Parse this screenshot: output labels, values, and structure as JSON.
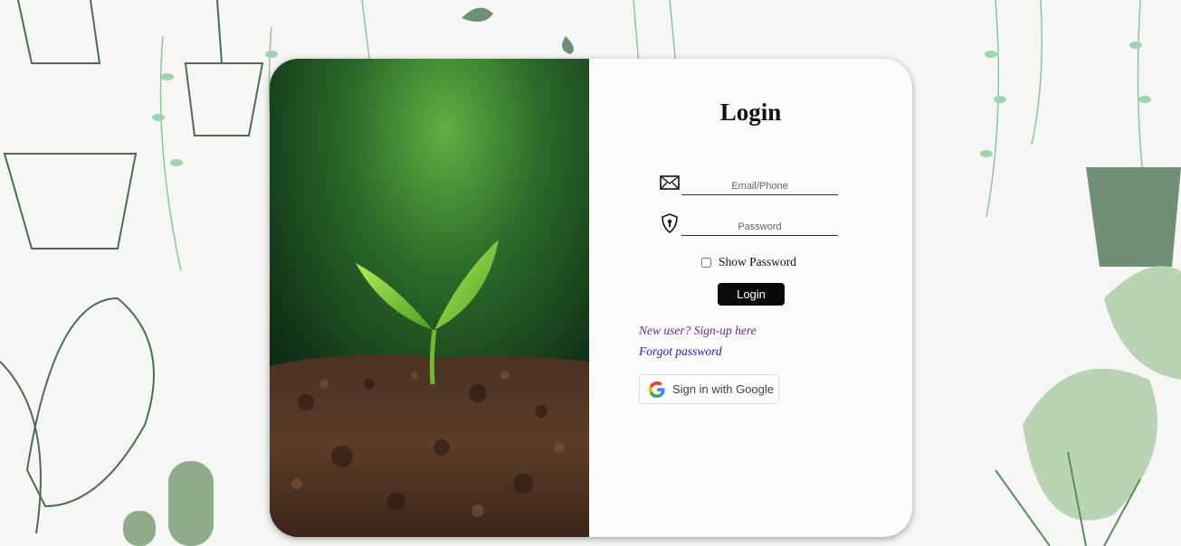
{
  "login": {
    "title": "Login",
    "email_placeholder": "Email/Phone",
    "password_placeholder": "Password",
    "show_password_label": "Show Password",
    "login_button": "Login",
    "signup_link": "New user? Sign-up here",
    "forgot_link": "Forgot password",
    "google_button": "Sign in with Google"
  },
  "icons": {
    "email": "envelope-icon",
    "password": "lock-shield-icon",
    "google": "google-g-icon"
  },
  "colors": {
    "background": "#f6f6f4",
    "card": "#fbfbf9",
    "button": "#0a0a0a",
    "visited_link": "#5b2d86",
    "link": "#2222cc",
    "leaf": "#7fb98f"
  }
}
